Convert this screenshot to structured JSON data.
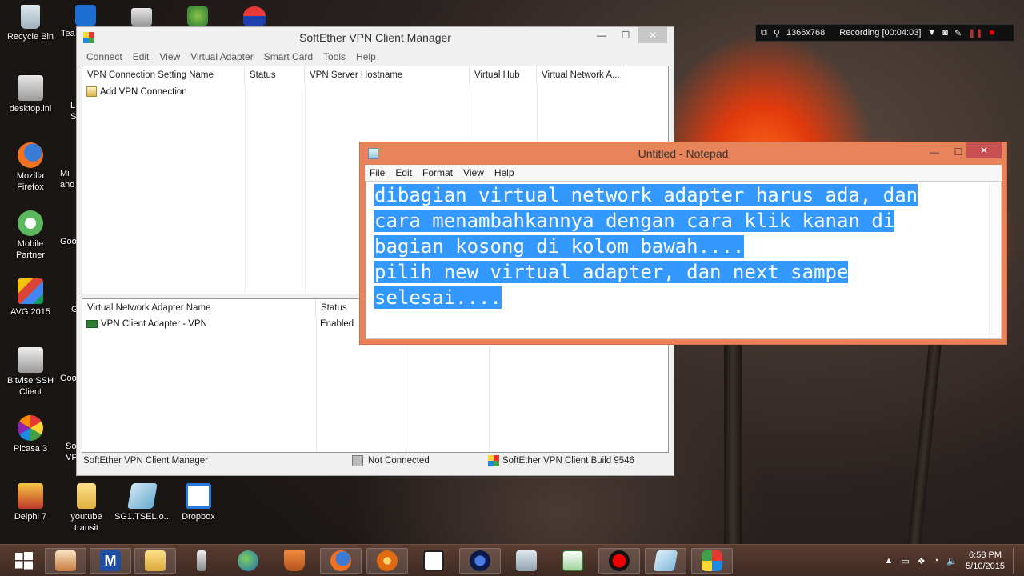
{
  "desktop": {
    "icons": [
      {
        "label": "Recycle Bin",
        "icon": "recycle-bin-icon"
      },
      {
        "label": "desktop.ini",
        "icon": "settings-file-icon"
      },
      {
        "label": "Mozilla Firefox",
        "icon": "firefox-icon"
      },
      {
        "label": "Mobile Partner",
        "icon": "mobile-partner-icon"
      },
      {
        "label": "AVG 2015",
        "icon": "avg-icon"
      },
      {
        "label": "Bitvise SSH Client",
        "icon": "bitvise-icon"
      },
      {
        "label": "Picasa 3",
        "icon": "picasa-icon"
      },
      {
        "label": "Delphi 7",
        "icon": "delphi-icon"
      },
      {
        "label": "youtube transit",
        "icon": "folder-icon"
      },
      {
        "label": "SG1.TSEL.o...",
        "icon": "vpn-config-icon"
      },
      {
        "label": "Dropbox",
        "icon": "dropbox-icon"
      }
    ],
    "partial_labels": [
      "Tea",
      "L",
      "S",
      "Mi",
      "and",
      "Goo",
      "G",
      "Goo",
      "So",
      "VP"
    ]
  },
  "recorder": {
    "resolution": "1366x768",
    "status": "Recording [00:04:03]"
  },
  "softether": {
    "title": "SoftEther VPN Client Manager",
    "menu": [
      "Connect",
      "Edit",
      "View",
      "Virtual Adapter",
      "Smart Card",
      "Tools",
      "Help"
    ],
    "connections": {
      "columns": [
        "VPN Connection Setting Name",
        "Status",
        "VPN Server Hostname",
        "Virtual Hub",
        "Virtual Network A..."
      ],
      "rows": [
        {
          "name": "Add VPN Connection"
        }
      ]
    },
    "adapters": {
      "columns": [
        "Virtual Network Adapter Name",
        "Status"
      ],
      "rows": [
        {
          "name": "VPN Client Adapter - VPN",
          "status": "Enabled"
        }
      ]
    },
    "statusbar": {
      "app": "SoftEther VPN Client Manager",
      "connection": "Not Connected",
      "build": "SoftEther VPN Client Build 9546"
    }
  },
  "notepad": {
    "title": "Untitled - Notepad",
    "menu": [
      "File",
      "Edit",
      "Format",
      "View",
      "Help"
    ],
    "lines": [
      "dibagian virtual network adapter harus ada, dan ",
      "cara menambahkannya dengan cara klik kanan di ",
      "bagian kosong di kolom bawah....",
      "pilih new virtual adapter, dan next sampe ",
      "selesai...."
    ]
  },
  "taskbar": {
    "apps": [
      "start-button",
      "java-app-icon",
      "maxthon-icon",
      "file-explorer-icon",
      "usb-icon",
      "network-globe-icon",
      "java-icon",
      "firefox-icon",
      "vlc-like-icon",
      "media-player-classic-icon",
      "softether-vpn-icon",
      "remote-desktop-icon",
      "notepad-plus-icon",
      "recorder-icon",
      "notepad-icon",
      "picasa-taskbar-icon"
    ],
    "time": "6:58 PM",
    "date": "5/10/2015"
  }
}
